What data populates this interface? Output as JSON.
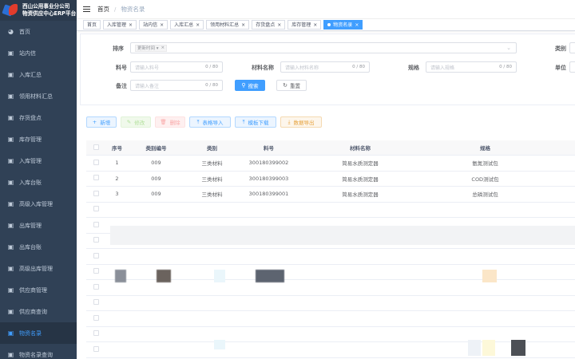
{
  "brand": {
    "line1": "西山公用事业分公司",
    "line2": "物资供应中心ERP平台"
  },
  "sidebar": {
    "items": [
      {
        "label": "首页",
        "icon": "dashboard-icon"
      },
      {
        "label": "站内信",
        "icon": "mail-icon"
      },
      {
        "label": "入库汇总",
        "icon": "list-icon"
      },
      {
        "label": "领用材料汇总",
        "icon": "list-icon"
      },
      {
        "label": "存货盘点",
        "icon": "list-icon"
      },
      {
        "label": "库存管理",
        "icon": "list-icon"
      },
      {
        "label": "入库管理",
        "icon": "list-icon"
      },
      {
        "label": "入库台账",
        "icon": "list-icon"
      },
      {
        "label": "高级入库管理",
        "icon": "list-icon"
      },
      {
        "label": "出库管理",
        "icon": "list-icon"
      },
      {
        "label": "出库台账",
        "icon": "list-icon"
      },
      {
        "label": "高级出库管理",
        "icon": "list-icon"
      },
      {
        "label": "供应商管理",
        "icon": "list-icon"
      },
      {
        "label": "供应商查询",
        "icon": "list-icon"
      },
      {
        "label": "物资名录",
        "icon": "list-icon"
      },
      {
        "label": "物资名录查询",
        "icon": "list-icon"
      }
    ],
    "active_index": 14
  },
  "breadcrumb": {
    "home": "首页",
    "sep": "/",
    "current": "物资名录"
  },
  "tabs": [
    {
      "label": "首页",
      "closable": false
    },
    {
      "label": "入库管理",
      "closable": true
    },
    {
      "label": "站内信",
      "closable": true
    },
    {
      "label": "入库汇总",
      "closable": true
    },
    {
      "label": "领用材料汇总",
      "closable": true
    },
    {
      "label": "存货盘点",
      "closable": true
    },
    {
      "label": "库存管理",
      "closable": true
    },
    {
      "label": "物资名录",
      "closable": true,
      "active": true
    }
  ],
  "search": {
    "sort_label": "排序",
    "sort_chip": "更新时间 ▾",
    "category_label": "类别",
    "material_no_label": "料号",
    "material_no_placeholder": "请输入料号",
    "material_name_label": "材料名称",
    "material_name_placeholder": "请输入材料名称",
    "spec_label": "规格",
    "spec_placeholder": "请输入规格",
    "unit_label": "单位",
    "remark_label": "备注",
    "remark_placeholder": "请输入备注",
    "counter": "0 / 80",
    "search_button": "搜索",
    "reset_button": "重置"
  },
  "toolbar": {
    "add": "新增",
    "edit": "修改",
    "delete": "删除",
    "import": "表格导入",
    "template": "模板下载",
    "export": "数据导出"
  },
  "table": {
    "headers": [
      "序号",
      "类别编号",
      "类别",
      "料号",
      "材料名称",
      "规格"
    ],
    "rows": [
      {
        "no": "1",
        "cat_code": "009",
        "category": "三类材料",
        "material_no": "300180399002",
        "name": "简易水质测定器",
        "spec": "氨氮测试包"
      },
      {
        "no": "2",
        "cat_code": "009",
        "category": "三类材料",
        "material_no": "300180399003",
        "name": "简易水质测定器",
        "spec": "COD测试包"
      },
      {
        "no": "3",
        "cat_code": "009",
        "category": "三类材料",
        "material_no": "300180399001",
        "name": "简易水质测定器",
        "spec": "总磷测试包"
      }
    ]
  },
  "colors": {
    "sidebar_bg": "#304156",
    "accent": "#409eff",
    "active_tag": "#409eff"
  }
}
